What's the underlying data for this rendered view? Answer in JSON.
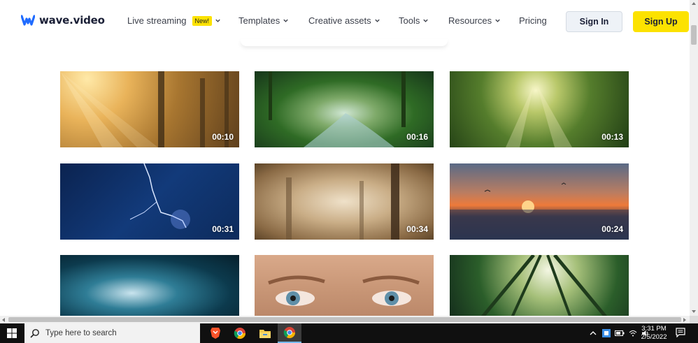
{
  "header": {
    "brand": "wave.video",
    "nav": [
      {
        "label": "Live streaming",
        "badge": "New!",
        "has_dropdown": true
      },
      {
        "label": "Templates",
        "has_dropdown": true
      },
      {
        "label": "Creative assets",
        "has_dropdown": true
      },
      {
        "label": "Tools",
        "has_dropdown": true
      },
      {
        "label": "Resources",
        "has_dropdown": true
      },
      {
        "label": "Pricing",
        "has_dropdown": false
      }
    ],
    "sign_in": "Sign In",
    "sign_up": "Sign Up"
  },
  "gallery": {
    "items": [
      {
        "duration": "00:10"
      },
      {
        "duration": "00:16"
      },
      {
        "duration": "00:13"
      },
      {
        "duration": "00:31"
      },
      {
        "duration": "00:34"
      },
      {
        "duration": "00:24"
      },
      {
        "duration": ""
      },
      {
        "duration": ""
      },
      {
        "duration": ""
      }
    ]
  },
  "taskbar": {
    "search_placeholder": "Type here to search",
    "time": "3:31 PM",
    "date": "2/5/2022",
    "apps": [
      "brave-browser-icon",
      "chrome-icon",
      "file-explorer-icon",
      "chrome-active-icon"
    ]
  },
  "colors": {
    "accent_yellow": "#fce200",
    "brand_blue": "#1f6bff",
    "taskbar": "#101010"
  }
}
